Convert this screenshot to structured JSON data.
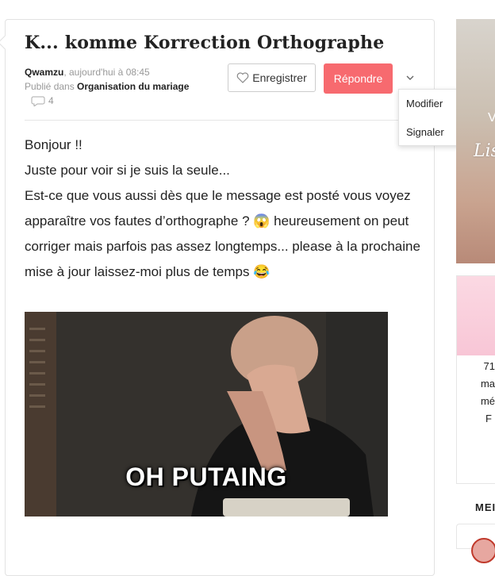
{
  "post": {
    "title": "K... komme Korrection Orthographe",
    "author": "Qwamzu",
    "time": ", aujourd'hui à 08:45",
    "published_prefix": "Publié dans ",
    "category": "Organisation du mariage",
    "comment_count": "4",
    "body": [
      "Bonjour !!",
      "Juste pour voir si je suis la seule...",
      "Est-ce que vous aussi dès que le message est posté vous voyez apparaître vos fautes d’orthographe ? 😱 heureusement on peut corriger mais parfois pas assez longtemps... please à la prochaine mise à jour laissez-moi plus de temps 😂"
    ],
    "image_caption": "OH PUTAING"
  },
  "actions": {
    "save_label": "Enregistrer",
    "reply_label": "Répondre"
  },
  "menu": {
    "items": [
      "Modifier",
      "Signaler"
    ]
  },
  "sidebar": {
    "banner_letter": "V",
    "banner_word": "Lis",
    "card_lines": [
      "71",
      "ma",
      "mé",
      "F"
    ],
    "footer_label": "MEI"
  },
  "colors": {
    "accent": "#f76a6f"
  }
}
